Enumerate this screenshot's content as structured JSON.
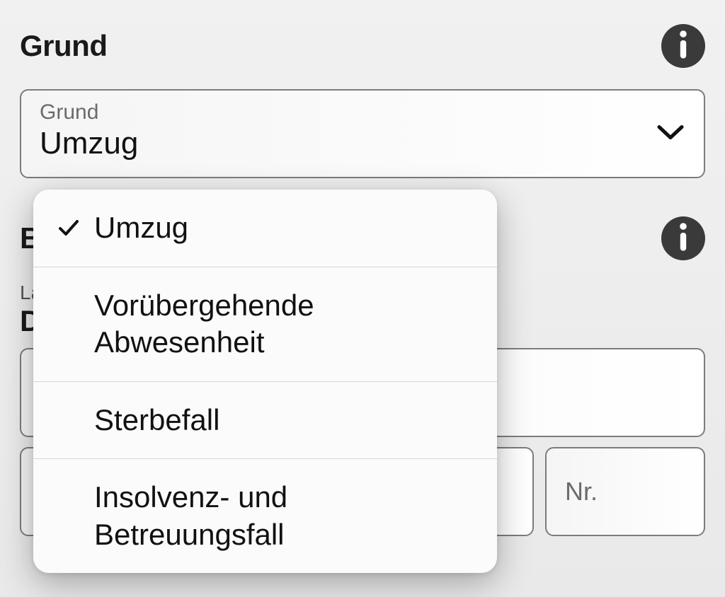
{
  "section1": {
    "title": "Grund",
    "select": {
      "label": "Grund",
      "value": "Umzug"
    }
  },
  "dropdown": {
    "options": [
      {
        "label": "Umzug",
        "selected": true
      },
      {
        "label": "Vorübergehende Abwesenheit",
        "selected": false
      },
      {
        "label": "Sterbefall",
        "selected": false
      },
      {
        "label": "Insolvenz- und Betreuungsfall",
        "selected": false
      }
    ]
  },
  "section2": {
    "title_truncated": "B",
    "subline_truncated": "La",
    "boldline_truncated": "D",
    "nr_placeholder": "Nr."
  },
  "icons": {
    "info": "info-icon",
    "chevron": "chevron-down-icon",
    "check": "check-icon"
  }
}
